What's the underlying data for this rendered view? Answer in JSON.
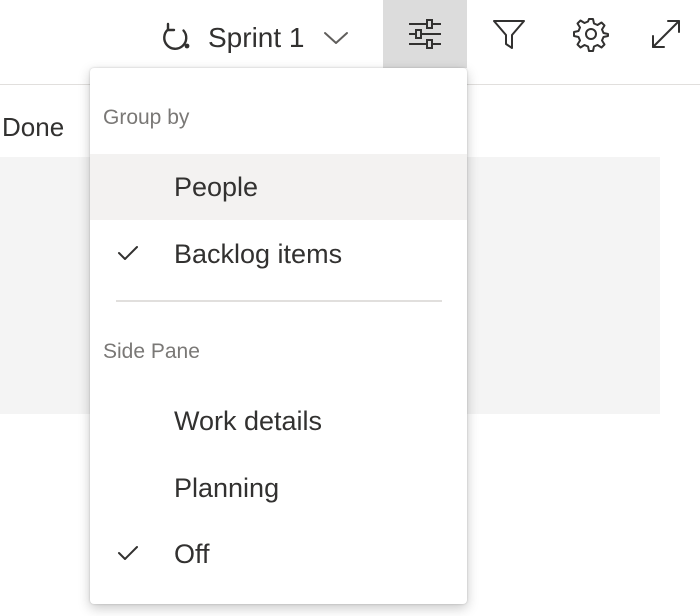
{
  "toolbar": {
    "sprint_label": "Sprint 1",
    "icons": {
      "iteration": "sprint-iteration-icon",
      "dropdown": "chevron-down-icon",
      "view_options": "sliders-icon",
      "filter": "filter-icon",
      "settings": "gear-icon",
      "expand": "expand-icon"
    }
  },
  "board": {
    "column_header": "Done"
  },
  "view_menu": {
    "group_by": {
      "title": "Group by",
      "items": [
        {
          "label": "People",
          "checked": false,
          "hovered": true
        },
        {
          "label": "Backlog items",
          "checked": true,
          "hovered": false
        }
      ]
    },
    "side_pane": {
      "title": "Side Pane",
      "items": [
        {
          "label": "Work details",
          "checked": false
        },
        {
          "label": "Planning",
          "checked": false
        },
        {
          "label": "Off",
          "checked": true
        }
      ]
    }
  },
  "colors": {
    "text": "#323130",
    "muted_text": "#7a7876",
    "active_button_bg": "#dcdcdc",
    "hover_bg": "#f3f2f1",
    "board_bg": "#f4f4f4",
    "divider": "#e1dfdd"
  }
}
